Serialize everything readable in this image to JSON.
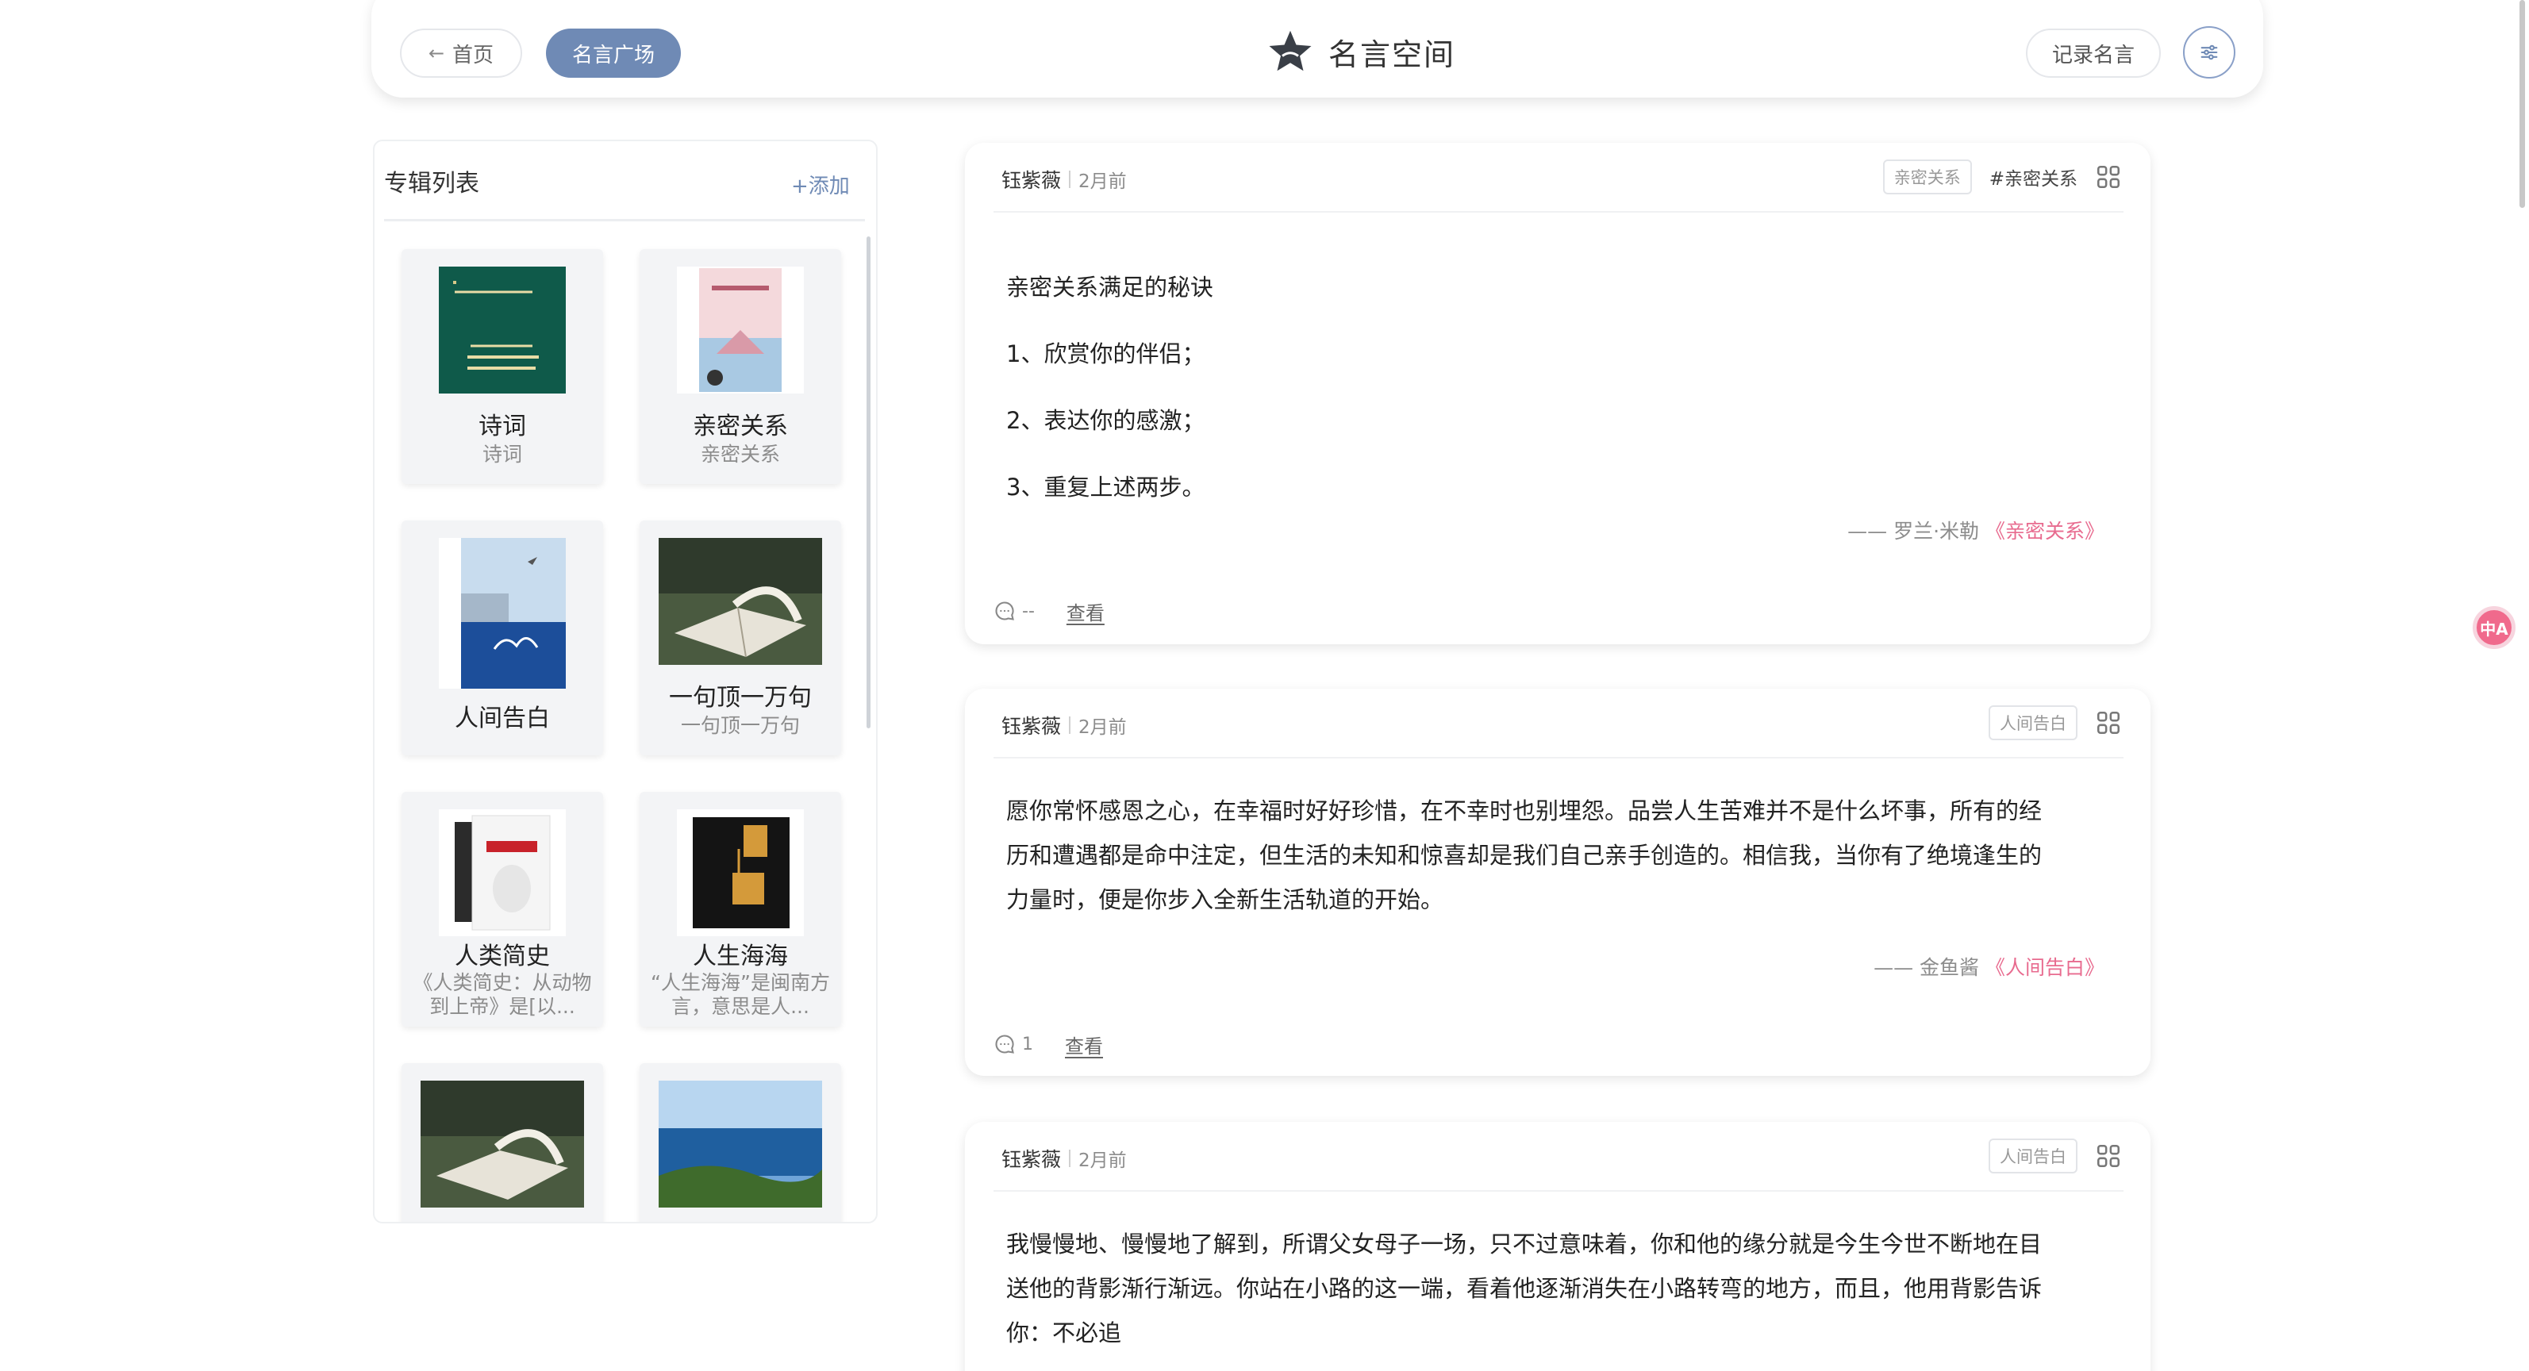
{
  "header": {
    "home_label": "首页",
    "square_label": "名言广场",
    "title": "名言空间",
    "record_label": "记录名言"
  },
  "sidebar": {
    "title": "专辑列表",
    "add_label": "+添加",
    "albums": [
      {
        "name": "诗词",
        "desc": "诗词"
      },
      {
        "name": "亲密关系",
        "desc": "亲密关系"
      },
      {
        "name": "人间告白",
        "desc": ""
      },
      {
        "name": "一句顶一万句",
        "desc": "一句顶一万句"
      },
      {
        "name": "人类简史",
        "desc": "《人类简史：从动物到上帝》是[以..."
      },
      {
        "name": "人生海海",
        "desc": "“人生海海”是闽南方言，意思是人..."
      }
    ]
  },
  "posts": [
    {
      "author": "钰紫薇",
      "time": "2月前",
      "tag": "亲密关系",
      "topic": "#亲密关系",
      "lines": [
        "亲密关系满足的秘诀",
        "1、欣赏你的伴侣；",
        "2、表达你的感激；",
        "3、重复上述两步。"
      ],
      "source_prefix": "—— 罗兰·米勒",
      "source_book": "《亲密关系》",
      "comment_count": "--",
      "view_label": "查看"
    },
    {
      "author": "钰紫薇",
      "time": "2月前",
      "tag": "人间告白",
      "lines": [
        "愿你常怀感恩之心，在幸福时好好珍惜，在不幸时也别埋怨。品尝人生苦难并不是什么坏事，所有的经",
        "历和遭遇都是命中注定，但生活的未知和惊喜却是我们自己亲手创造的。相信我，当你有了绝境逢生的",
        "力量时，便是你步入全新生活轨道的开始。"
      ],
      "source_prefix": "—— 金鱼酱",
      "source_book": "《人间告白》",
      "comment_count": "1",
      "view_label": "查看"
    },
    {
      "author": "钰紫薇",
      "time": "2月前",
      "tag": "人间告白",
      "lines": [
        "我慢慢地、慢慢地了解到，所谓父女母子一场，只不过意味着，你和他的缘分就是今生今世不断地在目",
        "送他的背影渐行渐远。你站在小路的这一端，看着他逐渐消失在小路转弯的地方，而且，他用背影告诉",
        "你：不必追"
      ]
    }
  ],
  "translate_fab": "中A",
  "colors": {
    "accent": "#6f8ab5",
    "book_link": "#e86b8f"
  }
}
